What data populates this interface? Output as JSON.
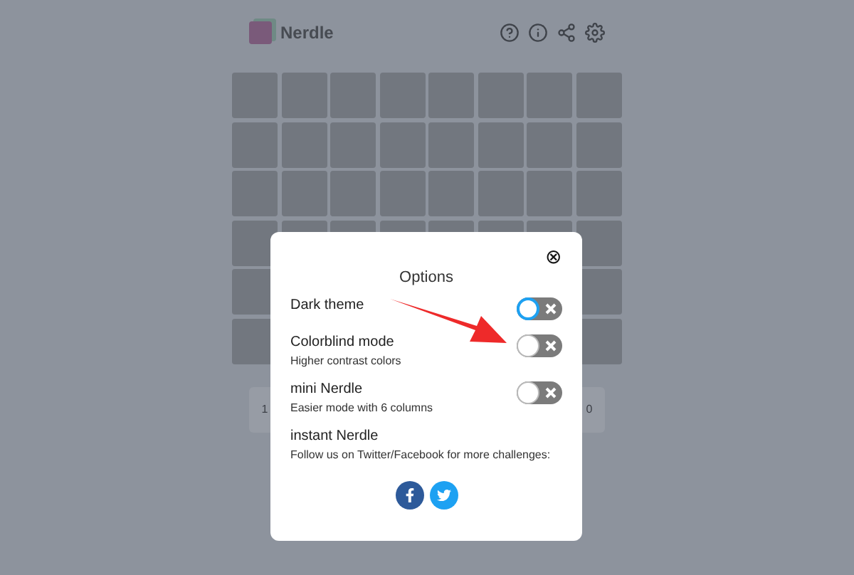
{
  "header": {
    "title": "Nerdle"
  },
  "keypad": {
    "keys": [
      "1",
      "0"
    ]
  },
  "dialog": {
    "title": "Options",
    "close": "⊗",
    "options": [
      {
        "kind": "toggle",
        "label": "Dark theme",
        "on": false,
        "focused": true
      },
      {
        "kind": "toggle",
        "label": "Colorblind mode",
        "hint": "Higher contrast colors",
        "on": false,
        "focused": false
      },
      {
        "kind": "toggle",
        "label": "mini Nerdle",
        "hint": "Easier mode with 6 columns",
        "on": false,
        "focused": false
      },
      {
        "kind": "text",
        "label": "instant Nerdle",
        "hint": "Follow us on Twitter/Facebook for more challenges:"
      }
    ],
    "social": [
      {
        "kind": "facebook"
      },
      {
        "kind": "twitter"
      }
    ]
  }
}
